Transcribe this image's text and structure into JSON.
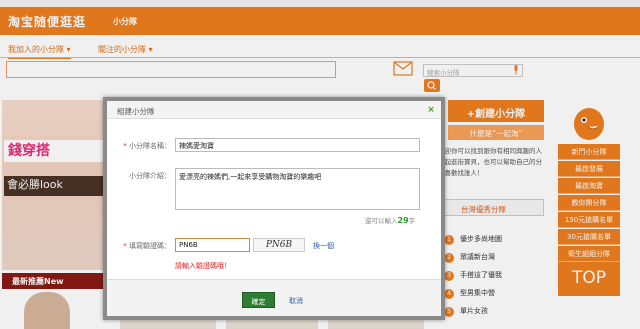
{
  "header": {
    "logo": "淘宝随便逛逛",
    "subtitle": "小分隊",
    "color": "#f07f1f"
  },
  "nav": {
    "tabs": [
      {
        "label": "我加入的小分隊"
      },
      {
        "label": "關注的小分隊"
      }
    ]
  },
  "search": {
    "placeholder": "搜索小分隊"
  },
  "banner": {
    "tag": "錢穿搭",
    "subtitle": "會必勝look"
  },
  "latest": {
    "label": "最新推薦New"
  },
  "sidebar": {
    "create_label": "+創建小分隊",
    "what_label": "什麼是“一起淘”",
    "description": "歡迎你可以找到跟你有相同興趣的人一起逛街寶貝，也可以幫助自己的分隊喜歡找誰人！",
    "ranking_title": "台灣優秀分隊",
    "ranking": [
      {
        "num": "1",
        "label": "優步多尚地圖"
      },
      {
        "num": "2",
        "label": "眾議新台灣"
      },
      {
        "num": "3",
        "label": "手搭這了優我"
      },
      {
        "num": "4",
        "label": "型男集中營"
      },
      {
        "num": "5",
        "label": "單片女孩"
      }
    ]
  },
  "right_menu": {
    "items": [
      "新門小分隊",
      "最啟發展",
      "最啟淘寶",
      "教你開分隊",
      "150元搶購名單",
      "30元搶購名單",
      "衛生組組分隊"
    ],
    "top_label": "TOP"
  },
  "dialog": {
    "title": "組建小分隊",
    "close": "×",
    "name_label": "小分隊名稱：",
    "name_value": "辣媽愛淘寶",
    "intro_label": "小分隊介紹：",
    "intro_value": "愛漂亮的辣媽們,一起來享受購物淘寶的樂趣吧",
    "counter_prefix": "還可以輸入",
    "counter_value": "29",
    "counter_suffix": "字",
    "captcha_label": "填寫驗證碼：",
    "captcha_value": "PN6B",
    "captcha_image_text": "PN6B",
    "refresh_label": "換一個",
    "error_text": "請輸入驗證碼哦！",
    "ok_label": "確定",
    "cancel_label": "取消",
    "accent": "#2e7d32"
  }
}
